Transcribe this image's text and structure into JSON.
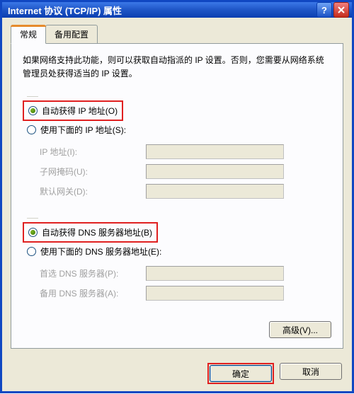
{
  "window": {
    "title": "Internet 协议 (TCP/IP) 属性"
  },
  "tabs": {
    "general": "常规",
    "alternate": "备用配置"
  },
  "desc": "如果网络支持此功能，则可以获取自动指派的 IP 设置。否则，您需要从网络系统管理员处获得适当的 IP 设置。",
  "ip": {
    "auto_label": "自动获得 IP 地址(O)",
    "manual_label": "使用下面的 IP 地址(S):",
    "ip_label": "IP 地址(I):",
    "mask_label": "子网掩码(U):",
    "gateway_label": "默认网关(D):"
  },
  "dns": {
    "auto_label": "自动获得 DNS 服务器地址(B)",
    "manual_label": "使用下面的 DNS 服务器地址(E):",
    "pref_label": "首选 DNS 服务器(P):",
    "alt_label": "备用 DNS 服务器(A):"
  },
  "buttons": {
    "advanced": "高级(V)...",
    "ok": "确定",
    "cancel": "取消"
  }
}
